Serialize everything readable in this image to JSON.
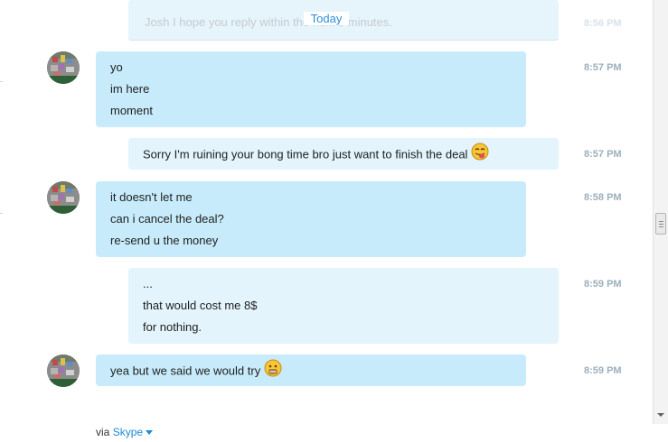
{
  "day_separator": "Today",
  "previous_message": {
    "text": "Josh I hope you reply within the next 5 minutes.",
    "time": "8:56 PM"
  },
  "messages": [
    {
      "direction": "in",
      "lines": [
        "yo",
        "im here",
        "moment"
      ],
      "time": "8:57 PM"
    },
    {
      "direction": "out",
      "lines": [
        "Sorry I'm ruining your bong time bro just want to finish the deal"
      ],
      "emoji": "tongue-out-emoticon",
      "time": "8:57 PM"
    },
    {
      "direction": "in",
      "lines": [
        "it doesn't let me",
        "can i cancel the deal?",
        "re-send u the money"
      ],
      "time": "8:58 PM"
    },
    {
      "direction": "out",
      "lines": [
        "...",
        "that would cost me 8$",
        "for nothing."
      ],
      "time": "8:59 PM"
    },
    {
      "direction": "in",
      "lines": [
        "yea but we said we would try"
      ],
      "emoji": "worried-emoticon",
      "time": "8:59 PM"
    }
  ],
  "footer": {
    "via_label": "via",
    "service_link": "Skype"
  },
  "colors": {
    "accent": "#1c8bd3",
    "incoming_bubble": "#c7ebfa",
    "outgoing_bubble": "#e3f4fc",
    "timestamp": "#9bb0bd"
  }
}
